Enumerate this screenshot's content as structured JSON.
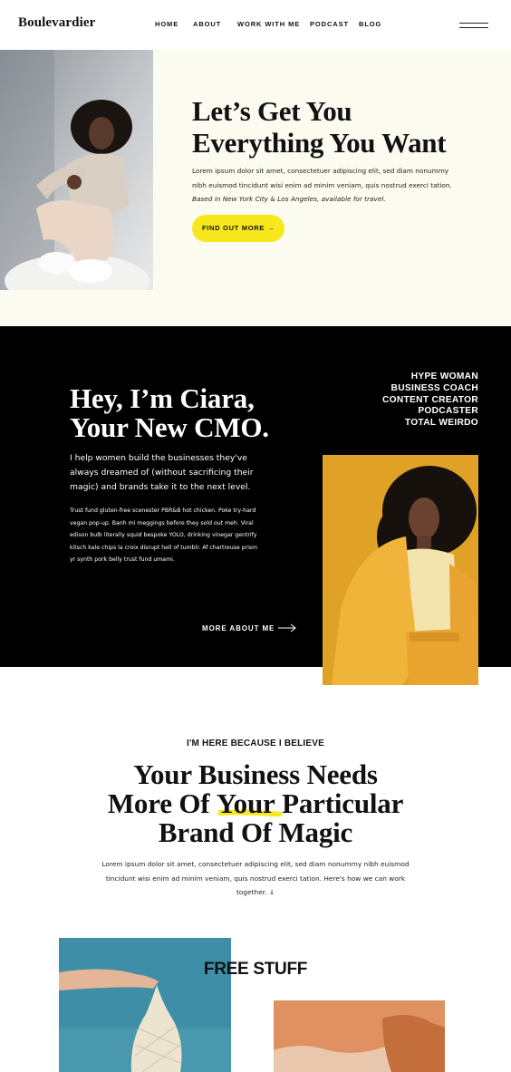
{
  "brand": {
    "logo": "Boulevardier"
  },
  "nav": {
    "items": [
      "HOME",
      "ABOUT",
      "WORK WITH ME",
      "PODCAST",
      "BLOG"
    ],
    "menu_icon": "hamburger-icon"
  },
  "hero": {
    "title_line1": "Let’s Get You",
    "title_line2": "Everything You Want",
    "body": "Lorem ipsum dolor sit amet, consectetuer adipiscing elit, sed diam nonummy nibh euismod tincidunt wisi enim ad minim veniam, quis nostrud exerci tation.",
    "body_italic": "Based in New York City & Los Angeles, available for travel.",
    "cta": "FIND OUT MORE →"
  },
  "about": {
    "title_line1": "Hey, I’m Ciara,",
    "title_line2": "Your New CMO.",
    "lead": "I help women build the businesses they've always dreamed of (without sacrificing their magic) and brands take it to the next level.",
    "body": "Trust fund gluten-free scenester PBR&B hot chicken. Poke try-hard vegan pop-up. Banh mi meggings before they sold out meh. Viral edison bulb literally squid bespoke YOLO, drinking vinegar gentrify kitsch kale chips la croix disrupt hell of tumblr. Af chartreuse prism yr synth pork belly trust fund umami.",
    "roles": [
      "HYPE WOMAN",
      "BUSINESS COACH",
      "CONTENT CREATOR",
      "PODCASTER",
      "TOTAL WEIRDO"
    ],
    "more_link": "MORE ABOUT ME"
  },
  "believe": {
    "kicker": "I'M HERE BECAUSE I BELIEVE",
    "title_line1": "Your Business Needs",
    "title_line2_pre": "More Of ",
    "title_line2_highlight": "Your",
    "title_line2_post": " Particular",
    "title_line3": "Brand Of Magic",
    "body": "Lorem ipsum dolor sit amet, consectetuer adipiscing elit, sed diam nonummy nibh euismod tincidunt wisi enim ad minim veniam, quis nostrud exerci tation. Here's how we can work together. ↓"
  },
  "free": {
    "title": "FREE STUFF"
  },
  "colors": {
    "accent_yellow": "#f8e71c",
    "hero_bg": "#fcfbf0",
    "dark_bg": "#000000"
  }
}
